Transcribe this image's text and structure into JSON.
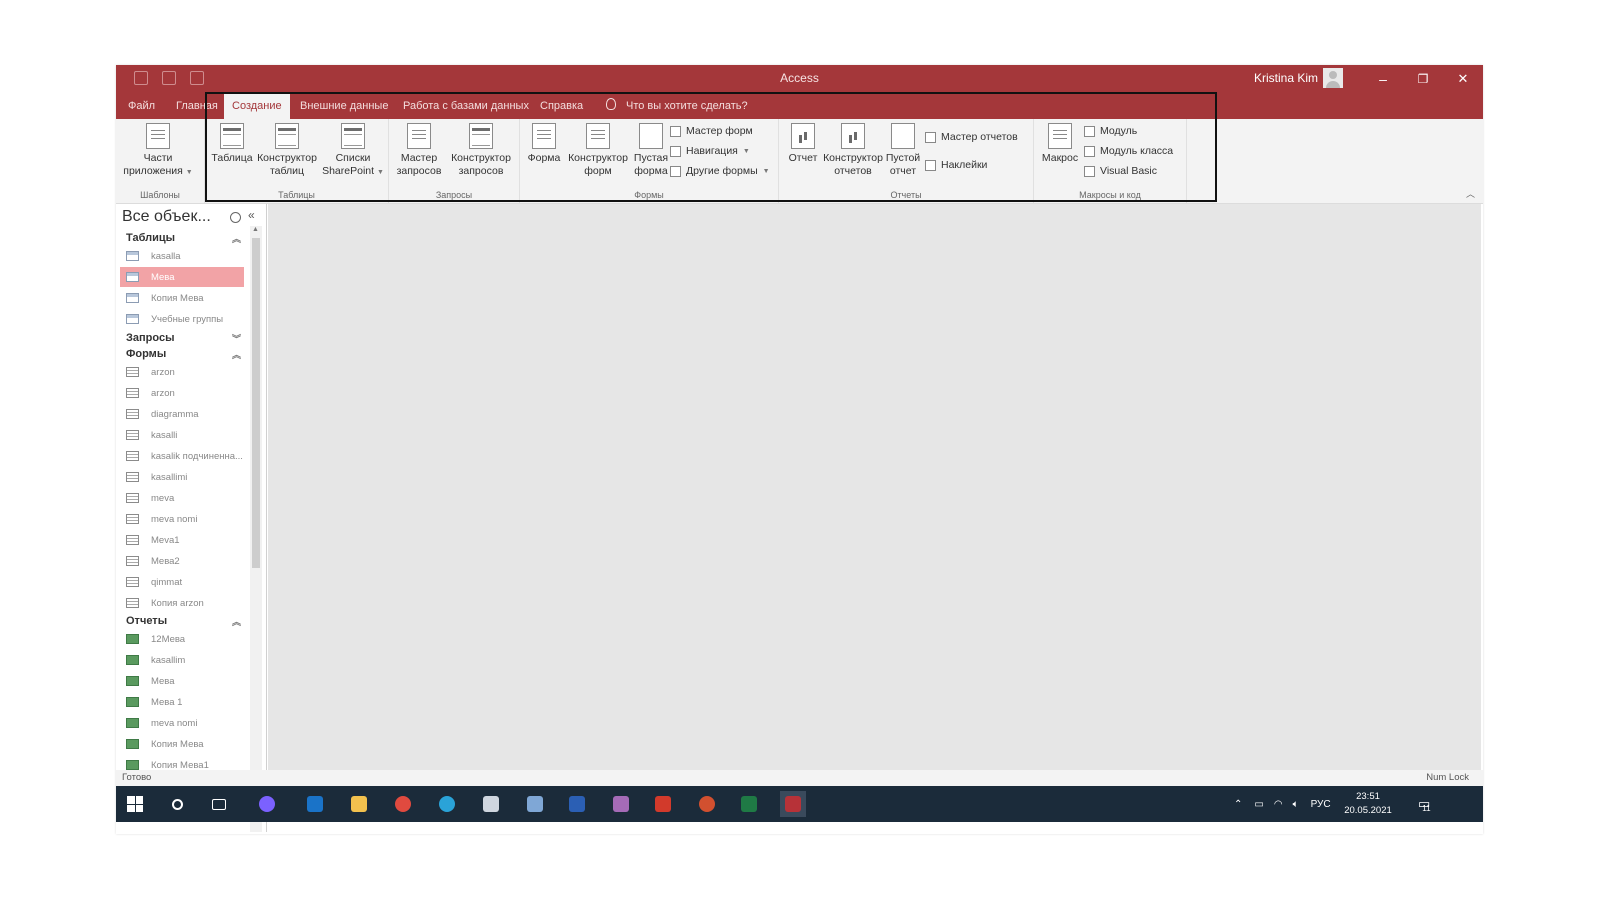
{
  "window": {
    "title": "Access",
    "user": "Kristina Kim",
    "controls": {
      "minimize": "–",
      "restore": "❐",
      "close": "✕"
    }
  },
  "tabs": [
    {
      "label": "Файл"
    },
    {
      "label": "Главная"
    },
    {
      "label": "Создание",
      "active": true
    },
    {
      "label": "Внешние данные"
    },
    {
      "label": "Работа с базами данных"
    },
    {
      "label": "Справка"
    },
    {
      "label": "Что вы хотите сделать?"
    }
  ],
  "ribbon": {
    "templates": {
      "label": "Шаблоны",
      "parts_line1": "Части",
      "parts_line2": "приложения"
    },
    "tables": {
      "label": "Таблицы",
      "table": "Таблица",
      "designer_line1": "Конструктор",
      "designer_line2": "таблиц",
      "sp_line1": "Списки",
      "sp_line2": "SharePoint"
    },
    "queries": {
      "label": "Запросы",
      "wizard_line1": "Мастер",
      "wizard_line2": "запросов",
      "designer_line1": "Конструктор",
      "designer_line2": "запросов"
    },
    "forms": {
      "label": "Формы",
      "form": "Форма",
      "designer_line1": "Конструктор",
      "designer_line2": "форм",
      "blank_line1": "Пустая",
      "blank_line2": "форма",
      "wizard": "Мастер форм",
      "navigation": "Навигация",
      "other": "Другие формы"
    },
    "reports": {
      "label": "Отчеты",
      "report": "Отчет",
      "designer_line1": "Конструктор",
      "designer_line2": "отчетов",
      "blank_line1": "Пустой",
      "blank_line2": "отчет",
      "wizard": "Мастер отчетов",
      "labels": "Наклейки"
    },
    "macros": {
      "label": "Макросы и код",
      "macro": "Макрос",
      "module": "Модуль",
      "class_module": "Модуль класса",
      "vb": "Visual Basic"
    }
  },
  "nav": {
    "title": "Все объек...",
    "sections": {
      "tables": {
        "label": "Таблицы",
        "items": [
          "kasalla",
          "Мева",
          "Копия Мева",
          "Учебные группы"
        ]
      },
      "queries": {
        "label": "Запросы"
      },
      "forms": {
        "label": "Формы",
        "items": [
          "arzon",
          "arzon",
          "diagramma",
          "kasalli",
          "kasalik подчиненна...",
          "kasallimi",
          "meva",
          "meva nomi",
          "Meva1",
          "Mева2",
          "qimmat",
          "Копия arzon"
        ]
      },
      "reports": {
        "label": "Отчеты",
        "items": [
          "12Мева",
          "kasallim",
          "Мева",
          "Мева 1",
          "meva nomi",
          "Копия Мева",
          "Копия Мева1"
        ]
      }
    }
  },
  "status": {
    "left": "Готово",
    "right": "Num Lock"
  },
  "taskbar": {
    "apps": [
      {
        "name": "start-icon",
        "color": "#ffffff"
      },
      {
        "name": "search-icon",
        "color": "#ffffff"
      },
      {
        "name": "task-view-icon",
        "color": "#ffffff"
      },
      {
        "name": "teams-icon",
        "color": "#7b61ff"
      },
      {
        "name": "outlook-icon",
        "color": "#1a73c8"
      },
      {
        "name": "file-explorer-icon",
        "color": "#f2c14e"
      },
      {
        "name": "chrome-icon",
        "color": "#e04a3f"
      },
      {
        "name": "edge-icon",
        "color": "#2aa3d8"
      },
      {
        "name": "3d-viewer-icon",
        "color": "#cfd6df"
      },
      {
        "name": "snip-icon",
        "color": "#7fa7d6"
      },
      {
        "name": "word-icon",
        "color": "#2b5fb4"
      },
      {
        "name": "winrar-icon",
        "color": "#a56bb7"
      },
      {
        "name": "acrobat-icon",
        "color": "#d23a2b"
      },
      {
        "name": "powerpoint-icon",
        "color": "#d2502f"
      },
      {
        "name": "excel-icon",
        "color": "#1f7a45"
      },
      {
        "name": "access-icon",
        "color": "#b73238"
      }
    ],
    "language": "РУС",
    "time": "23:51",
    "date": "20.05.2021",
    "notification_count": "11"
  },
  "colors": {
    "accent": "#a4373a",
    "selected_item": "#f2a3a6",
    "taskbar": "#1b2b3a"
  }
}
